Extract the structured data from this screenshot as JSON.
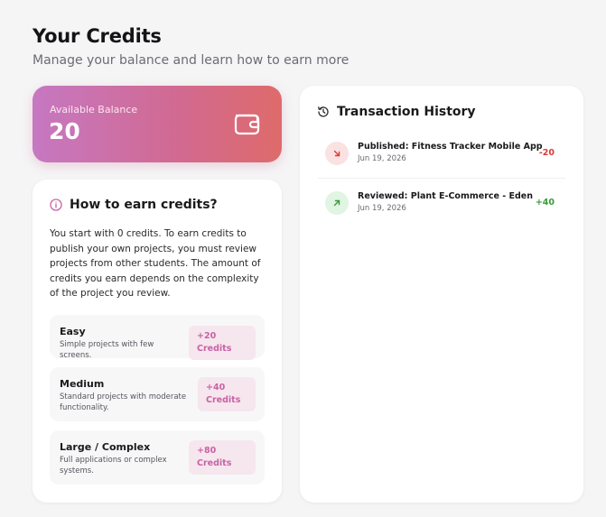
{
  "header": {
    "title": "Your Credits",
    "subtitle": "Manage your balance and learn how to earn more"
  },
  "balance": {
    "label": "Available Balance",
    "value": "20",
    "icon": "wallet-icon"
  },
  "earn": {
    "icon": "info-icon",
    "title": "How to earn credits?",
    "description": "You start with 0 credits. To earn credits to publish your own projects, you must review projects from other students. The amount of credits you earn depends on the complexity of the project you review.",
    "tiers": [
      {
        "name": "Easy",
        "description": "Simple projects with few screens.",
        "badge": "+20 Credits"
      },
      {
        "name": "Medium",
        "description": "Standard projects with moderate functionality.",
        "badge": "+40 Credits"
      },
      {
        "name": "Large / Complex",
        "description": "Full applications or complex systems.",
        "badge": "+80 Credits"
      }
    ]
  },
  "transactions": {
    "icon": "history-icon",
    "title": "Transaction History",
    "items": [
      {
        "type": "out",
        "name": "Published: Fitness Tracker Mobile App",
        "date": "Jun 19, 2026",
        "amount": "-20"
      },
      {
        "type": "in",
        "name": "Reviewed: Plant E-Commerce - Eden",
        "date": "Jun 19, 2026",
        "amount": "+40"
      }
    ]
  },
  "colors": {
    "gradient_start": "#c678c2",
    "gradient_end": "#de6b6b",
    "badge_text": "#c862a4",
    "negative": "#d63b3b",
    "positive": "#3a9a3a"
  }
}
